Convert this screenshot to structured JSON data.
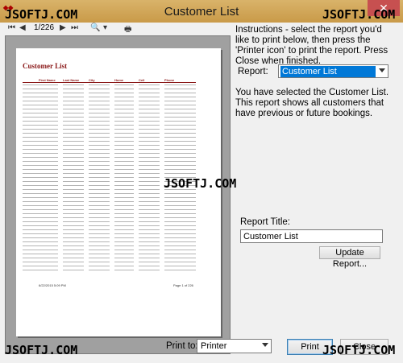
{
  "window": {
    "title": "Customer List",
    "close_glyph": "✕",
    "app_icon": "app-logo-icon"
  },
  "watermark": "JSOFTJ.COM",
  "toolbar": {
    "first_glyph": "⏮",
    "prev_glyph": "◀",
    "page_counter": "1/226",
    "next_glyph": "▶",
    "last_glyph": "⏭",
    "zoom_glyph": "🔍",
    "zoom_arrow": "▾",
    "print_glyph": "🖶"
  },
  "preview": {
    "doc_title": "Customer List",
    "columns": [
      "First Name",
      "Last Name",
      "City",
      "Home",
      "Cell",
      "Phone"
    ],
    "footer_left": "6/22/2015 5:09 PM",
    "footer_right": "Page 1 of 226"
  },
  "instructions": "Instructions - select the report you'd like to print below, then press the 'Printer icon' to print the report. Press Close when finished.",
  "report": {
    "label": "Report:",
    "selected": "Customer List"
  },
  "description": "You have selected the Customer List. This report shows all customers that have previous or future bookings.",
  "report_title": {
    "label": "Report Title:",
    "value": "Customer List"
  },
  "update_button": "Update Report...",
  "print_to": {
    "label": "Print to:",
    "selected": "Printer"
  },
  "print_button": "Print",
  "close_button": "Close",
  "colors": {
    "titlebar": "#c99a48",
    "accent": "#0078d7",
    "close": "#c75050",
    "doc_heading": "#8b1a1a"
  }
}
